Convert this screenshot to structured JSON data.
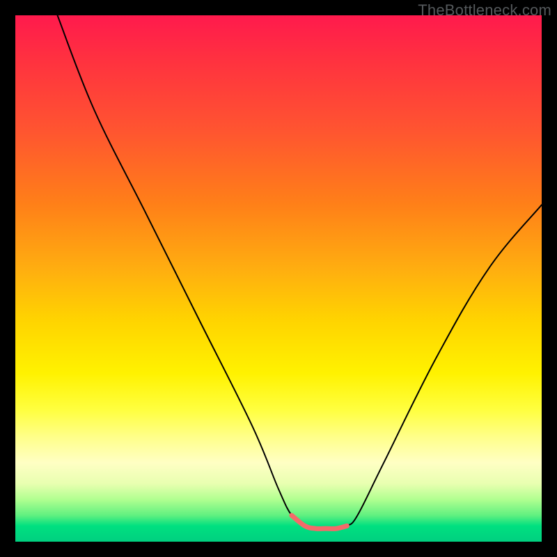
{
  "watermark": "TheBottleneck.com",
  "chart_data": {
    "type": "line",
    "title": "",
    "xlabel": "",
    "ylabel": "",
    "xlim": [
      0,
      100
    ],
    "ylim": [
      0,
      100
    ],
    "background": "rainbow-gradient-red-to-green-vertical",
    "series": [
      {
        "name": "bottleneck-curve",
        "color": "#000000",
        "x": [
          8,
          15,
          25,
          35,
          45,
          50,
          52.5,
          55,
          57,
          59,
          61,
          63,
          65,
          70,
          80,
          90,
          100
        ],
        "y": [
          100,
          82,
          62,
          42,
          22,
          10,
          5,
          3,
          2.5,
          2.5,
          2.5,
          3,
          5,
          15,
          35,
          52,
          64
        ]
      },
      {
        "name": "highlight-valley",
        "color": "#f46a6a",
        "stroke_width": 7,
        "x": [
          52.5,
          55,
          57,
          59,
          61,
          63
        ],
        "y": [
          5,
          3,
          2.5,
          2.5,
          2.5,
          3
        ]
      }
    ]
  }
}
